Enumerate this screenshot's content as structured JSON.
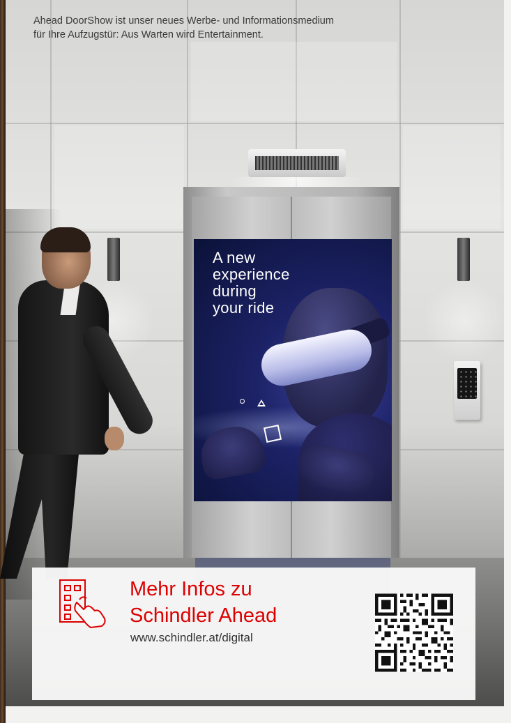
{
  "intro": {
    "line1": "Ahead DoorShow ist unser neues Werbe- und Informationsmedium",
    "line2": "für Ihre Aufzugstür: Aus Warten wird Entertainment."
  },
  "poster": {
    "headline_lines": [
      "A new",
      "experience",
      "during",
      "your ride"
    ]
  },
  "info_box": {
    "title_line1": "Mehr Infos zu",
    "title_line2": "Schindler Ahead",
    "url": "www.schindler.at/digital",
    "icon": "building-touch-icon",
    "qr_icon": "qr-code-icon"
  },
  "colors": {
    "brand_red": "#dc0000",
    "poster_blue": "#1c2266",
    "text_gray": "#333333"
  }
}
